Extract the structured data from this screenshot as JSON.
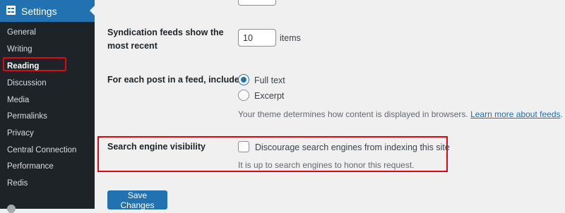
{
  "sidebar": {
    "section_title": "Settings",
    "section_icon": "settings-icon",
    "items": [
      {
        "label": "General"
      },
      {
        "label": "Writing"
      },
      {
        "label": "Reading",
        "current": true
      },
      {
        "label": "Discussion"
      },
      {
        "label": "Media"
      },
      {
        "label": "Permalinks"
      },
      {
        "label": "Privacy"
      },
      {
        "label": "Central Connection"
      },
      {
        "label": "Performance"
      },
      {
        "label": "Redis"
      }
    ]
  },
  "form": {
    "syndication": {
      "label": "Syndication feeds show the most recent",
      "value": "10",
      "suffix": "items"
    },
    "feed_content": {
      "label": "For each post in a feed, include",
      "options": [
        {
          "label": "Full text",
          "checked": true
        },
        {
          "label": "Excerpt",
          "checked": false
        }
      ],
      "description": "Your theme determines how content is displayed in browsers.",
      "link_text": "Learn more about feeds",
      "link_suffix": "."
    },
    "search_visibility": {
      "label": "Search engine visibility",
      "checkbox_label": "Discourage search engines from indexing this site",
      "checked": false,
      "description": "It is up to search engines to honor this request."
    },
    "save_label": "Save Changes"
  },
  "colors": {
    "accent": "#2271b1",
    "sidebar_bg": "#1d2327",
    "highlight_box": "#e10613"
  }
}
